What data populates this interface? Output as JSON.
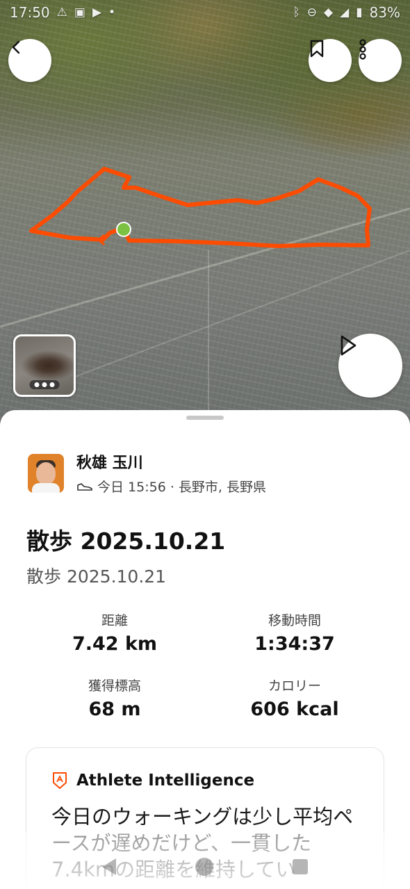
{
  "status_bar": {
    "time": "17:50",
    "battery": "83%",
    "left_icons": [
      "warning-icon",
      "linkedin-icon",
      "youtube-icon",
      "dot-icon"
    ],
    "right_icons": [
      "bluetooth-icon",
      "do-not-disturb-icon",
      "wifi-icon",
      "signal-icon",
      "battery-icon"
    ]
  },
  "map": {
    "route_color": "#FC4C02",
    "start_marker_color": "#7CC242"
  },
  "athlete": {
    "name": "秋雄 玉川",
    "activity_icon": "shoe-icon",
    "meta": "今日 15:56 · 長野市, 長野県"
  },
  "activity": {
    "title": "散歩 2025.10.21",
    "subtitle": "散歩 2025.10.21"
  },
  "stats": [
    {
      "label": "距離",
      "value": "7.42 km"
    },
    {
      "label": "移動時間",
      "value": "1:34:37"
    },
    {
      "label": "獲得標高",
      "value": "68 m"
    },
    {
      "label": "カロリー",
      "value": "606 kcal"
    }
  ],
  "athlete_intelligence": {
    "title": "Athlete Intelligence",
    "body": "今日のウォーキングは少し平均ペースが遅めだけど、一貫した7.4kmの距離を維持してい"
  },
  "colors": {
    "accent": "#FC4C02",
    "text_primary": "#111111",
    "text_secondary": "#555555"
  }
}
